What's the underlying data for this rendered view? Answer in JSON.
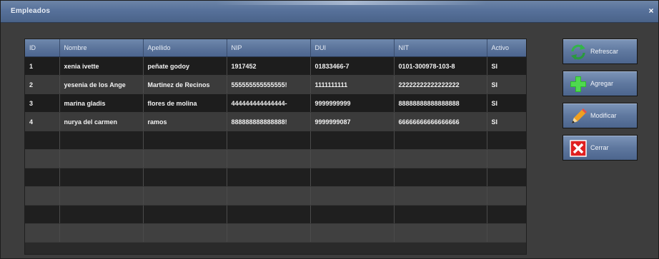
{
  "window": {
    "title": "Empleados",
    "close_glyph": "×"
  },
  "grid": {
    "columns": [
      "ID",
      "Nombre",
      "Apellido",
      "NIP",
      "DUI",
      "NIT",
      "Activo"
    ],
    "rows": [
      [
        "1",
        "xenia ivette",
        "peñate godoy",
        "1917452",
        "01833466-7",
        "0101-300978-103-8",
        "SI"
      ],
      [
        "2",
        "yesenia de los Ange",
        "Martinez de Recinos",
        "555555555555555!",
        "1111111111",
        "22222222222222222",
        "SI"
      ],
      [
        "3",
        "marina gladis",
        "flores de molina",
        "444444444444444-",
        "9999999999",
        "88888888888888888",
        "SI"
      ],
      [
        "4",
        "nurya del carmen",
        "ramos",
        "888888888888888!",
        "9999999087",
        "66666666666666666",
        "SI"
      ]
    ],
    "empty_row_count": 6
  },
  "buttons": {
    "refresh": {
      "label": "Refrescar",
      "icon": "refresh-icon"
    },
    "add": {
      "label": "Agregar",
      "icon": "plus-icon"
    },
    "edit": {
      "label": "Modificar",
      "icon": "pencil-icon"
    },
    "close": {
      "label": "Cerrar",
      "icon": "close-icon"
    }
  },
  "colors": {
    "titlebar": "#57719a",
    "row_dark": "#1d1d1d",
    "row_light": "#3b3b3b",
    "add_icon": "#2db82d",
    "close_icon": "#e02020",
    "refresh_icon": "#33b44a",
    "edit_icon": "#f0a020"
  }
}
